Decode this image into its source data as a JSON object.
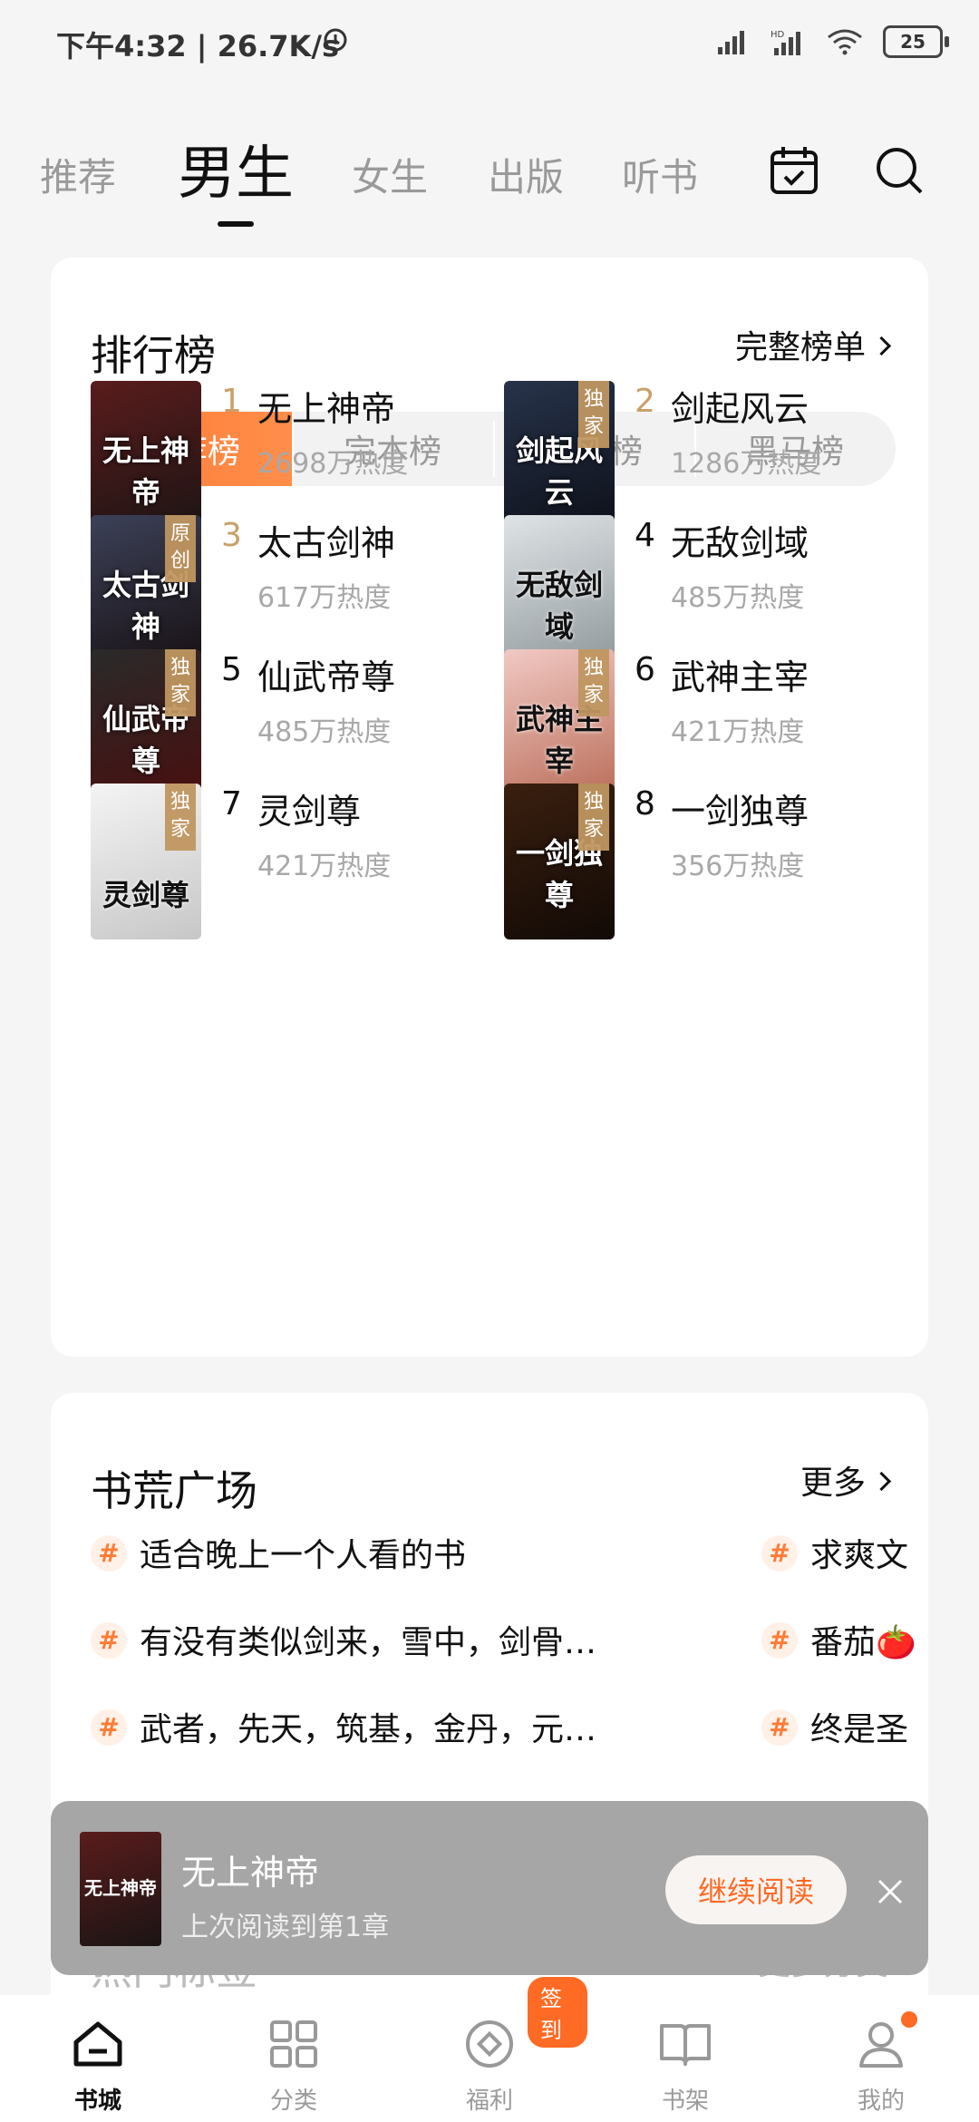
{
  "status_bar": {
    "time": "下午4:32 | 26.7K/s",
    "battery": "25"
  },
  "top_nav": {
    "tabs": [
      {
        "label": "推荐"
      },
      {
        "label": "男生",
        "active": true
      },
      {
        "label": "女生"
      },
      {
        "label": "出版"
      },
      {
        "label": "听书"
      }
    ],
    "icons": [
      "calendar-icon",
      "search-icon"
    ]
  },
  "ranking": {
    "title": "排行榜",
    "more": "完整榜单",
    "segments": [
      "推荐榜",
      "完本榜",
      "番茄榜",
      "黑马榜"
    ],
    "books": [
      {
        "rank": "1",
        "name": "无上神帝",
        "heat": "2698万热度",
        "badge": "",
        "cover_text": "无上神帝",
        "colors": [
          "#5a1c1c",
          "#1b1414"
        ]
      },
      {
        "rank": "2",
        "name": "剑起风云",
        "heat": "1286万热度",
        "badge": "独家",
        "cover_text": "剑起风云",
        "colors": [
          "#27334a",
          "#0d0f18"
        ]
      },
      {
        "rank": "3",
        "name": "太古剑神",
        "heat": "617万热度",
        "badge": "原创",
        "cover_text": "太古剑神",
        "colors": [
          "#3c4158",
          "#170f12"
        ]
      },
      {
        "rank": "4",
        "name": "无敌剑域",
        "heat": "485万热度",
        "badge": "",
        "cover_text": "无敌剑域",
        "colors": [
          "#dfe4e6",
          "#8e969a"
        ]
      },
      {
        "rank": "5",
        "name": "仙武帝尊",
        "heat": "485万热度",
        "badge": "独家",
        "cover_text": "仙武帝尊",
        "colors": [
          "#2a2a2a",
          "#4a0e0e"
        ]
      },
      {
        "rank": "6",
        "name": "武神主宰",
        "heat": "421万热度",
        "badge": "独家",
        "cover_text": "武神主宰",
        "colors": [
          "#f1c9c4",
          "#b86a55"
        ]
      },
      {
        "rank": "7",
        "name": "灵剑尊",
        "heat": "421万热度",
        "badge": "独家",
        "cover_text": "灵剑尊",
        "colors": [
          "#f4f4f4",
          "#c7c7c7"
        ]
      },
      {
        "rank": "8",
        "name": "一剑独尊",
        "heat": "356万热度",
        "badge": "独家",
        "cover_text": "一剑独尊",
        "colors": [
          "#3a1f0f",
          "#120a06"
        ]
      }
    ]
  },
  "square": {
    "title": "书荒广场",
    "more": "更多",
    "topics": [
      "适合晚上一个人看的书",
      "求爽文",
      "有没有类似剑来，雪中，剑骨…",
      "番茄🍅",
      "武者，先天，筑基，金丹，元…",
      "终是圣"
    ]
  },
  "hidden_section": {
    "title": "热门标签",
    "more": "更多分类"
  },
  "mini_player": {
    "title": "无上神帝",
    "subtitle": "上次阅读到第1章",
    "button": "继续阅读"
  },
  "bottom_nav": {
    "items": [
      {
        "label": "书城",
        "active": true
      },
      {
        "label": "分类"
      },
      {
        "label": "福利",
        "pill": "签到"
      },
      {
        "label": "书架"
      },
      {
        "label": "我的",
        "dot": true
      }
    ]
  },
  "colors": {
    "accent": "#ff7b35",
    "rank_gold": "#c9a06a"
  }
}
